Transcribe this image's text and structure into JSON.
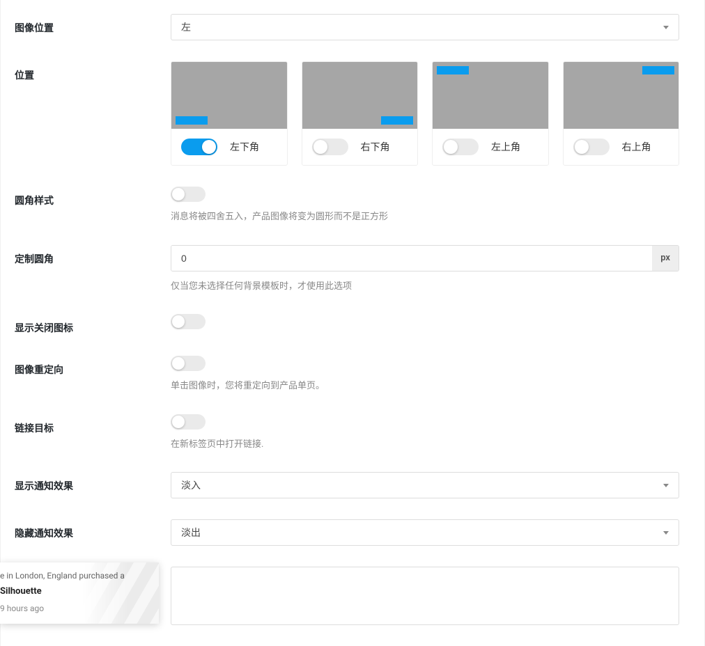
{
  "fields": {
    "image_position": {
      "label": "图像位置",
      "value": "左"
    },
    "position": {
      "label": "位置",
      "options": [
        {
          "label": "左下角",
          "on": true
        },
        {
          "label": "右下角",
          "on": false
        },
        {
          "label": "左上角",
          "on": false
        },
        {
          "label": "右上角",
          "on": false
        }
      ]
    },
    "rounded_style": {
      "label": "圆角样式",
      "help": "消息将被四舍五入，产品图像将变为圆形而不是正方形"
    },
    "custom_radius": {
      "label": "定制圆角",
      "value": "0",
      "unit": "px",
      "help": "仅当您未选择任何背景模板时，才使用此选项"
    },
    "show_close_icon": {
      "label": "显示关闭图标"
    },
    "image_redirect": {
      "label": "图像重定向",
      "help": "单击图像时，您将重定向到产品单页。"
    },
    "link_target": {
      "label": "链接目标",
      "help": "在新标签页中打开链接."
    },
    "show_effect": {
      "label": "显示通知效果",
      "value": "淡入"
    },
    "hide_effect": {
      "label": "隐藏通知效果",
      "value": "淡出"
    }
  },
  "notif": {
    "line1": "e in London, England purchased a",
    "product": "Silhouette",
    "time": "9 hours ago"
  }
}
